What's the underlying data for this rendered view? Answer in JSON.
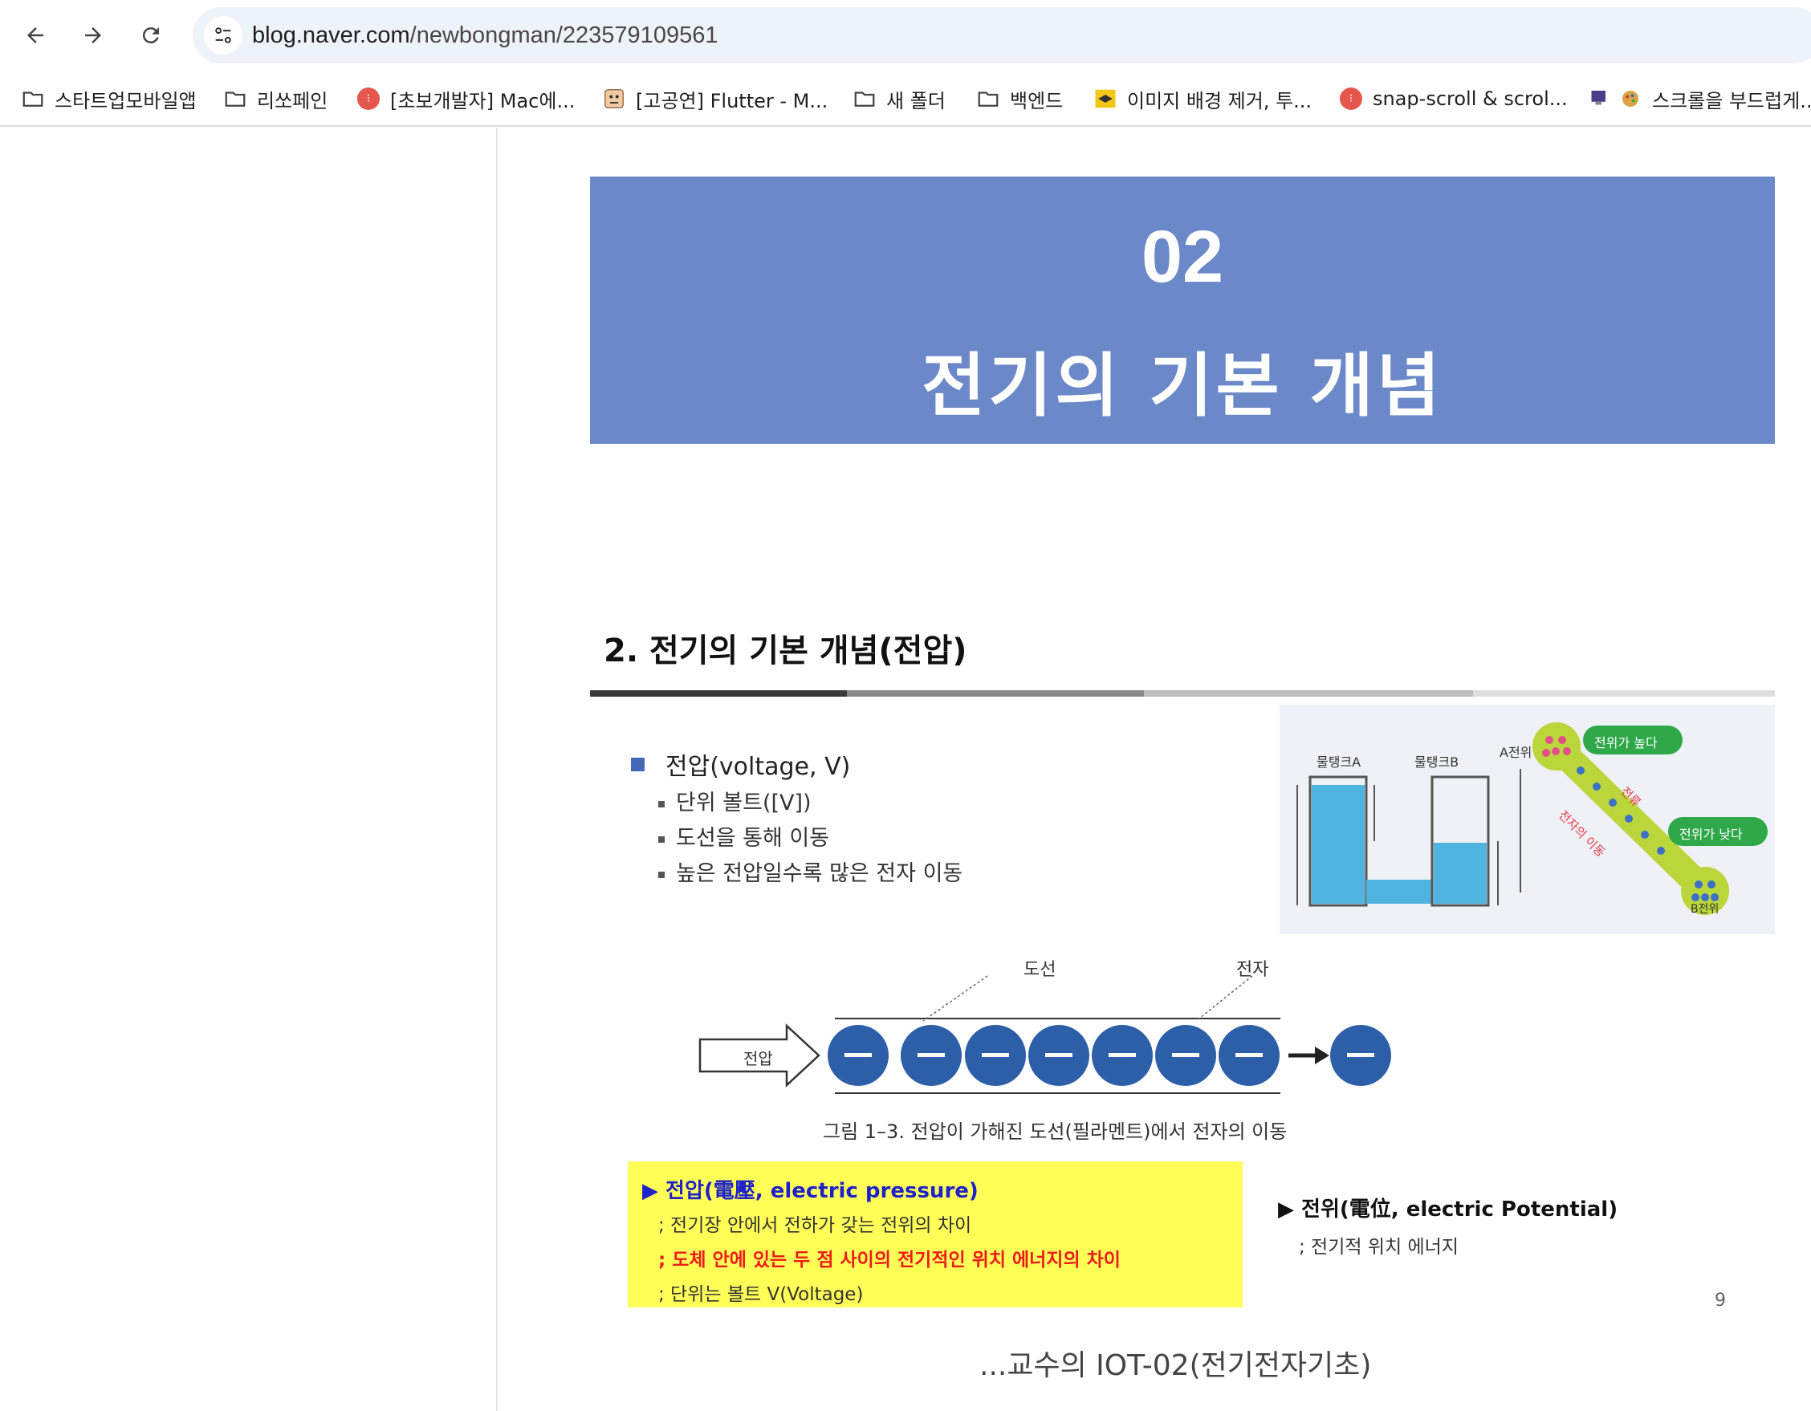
{
  "browser": {
    "url_host": "blog.naver.com",
    "url_path": "/newbongman/223579109561",
    "bookmarks": [
      {
        "label": "스타트업모바일앱",
        "icon": "folder-icon"
      },
      {
        "label": "리쏘페인",
        "icon": "folder-icon"
      },
      {
        "label": "[초보개발자] Mac에...",
        "icon": "favicon-red"
      },
      {
        "label": "[고공연] Flutter - M...",
        "icon": "favicon-face"
      },
      {
        "label": "새 폴더",
        "icon": "folder-icon"
      },
      {
        "label": "백엔드",
        "icon": "folder-icon"
      },
      {
        "label": "이미지 배경 제거, 투...",
        "icon": "favicon-yellow"
      },
      {
        "label": "snap-scroll & scrol...",
        "icon": "favicon-red"
      },
      {
        "label": "스크롤을 부드럽게...",
        "icon": "favicon-monitor"
      }
    ]
  },
  "banner": {
    "number": "02",
    "title": "전기의 기본 개념"
  },
  "slide": {
    "title": "2. 전기의 기본 개념(전압)",
    "bullet": "전압(voltage, V)",
    "sub_items": [
      "단위 볼트([V])",
      "도선을 통해 이동",
      "높은 전압일수록 많은 전자 이동"
    ],
    "photo_labels": {
      "tank_a": "물탱크A",
      "tank_b": "물탱크B",
      "a_potential": "A전위",
      "b_potential": "B전위",
      "high": "전위가 높다",
      "low": "전위가 낮다",
      "current": "전류",
      "electron_move": "전자의 이동"
    },
    "diagram": {
      "wire_label": "도선",
      "electron_label": "전자",
      "voltage_label": "전압",
      "electron_symbol": "—",
      "caption": "그림 1–3. 전압이 가해진 도선(필라멘트)에서 전자의 이동"
    },
    "definition": {
      "heading": "▶ 전압(電壓, electric pressure)",
      "line1": "; 전기장 안에서 전하가 갖는 전위의 차이",
      "line2": "; 도체 안에 있는 두 점 사이의 전기적인 위치 에너지의 차이",
      "line3": "; 단위는 볼트 V(Voltage)"
    },
    "potential": {
      "heading": "▶ 전위(電位, electric Potential)",
      "desc": "; 전기적 위치 에너지"
    },
    "page_number": "9"
  },
  "post_caption": "...교수의 IOT-02(전기전자기초)",
  "colors": {
    "banner_bg": "#6b88c8",
    "electron_fill": "#2c5fa8",
    "highlight_box": "#ffff57",
    "definition_heading": "#1e22c8",
    "definition_emphasis": "#ee1b1b"
  }
}
